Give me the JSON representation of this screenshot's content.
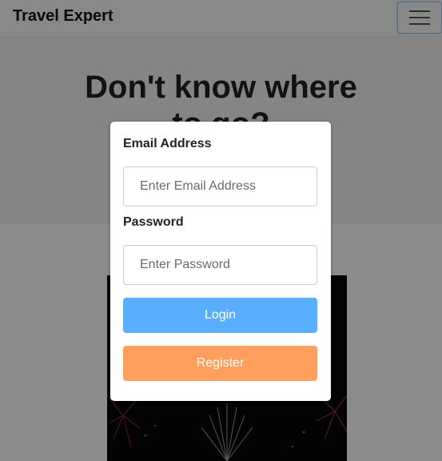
{
  "navbar": {
    "brand": "Travel Expert",
    "menu_icon": "hamburger-menu-icon"
  },
  "hero": {
    "title_line1": "Don't know where",
    "title_line2": "to go?"
  },
  "login_modal": {
    "email_label": "Email Address",
    "email_placeholder": "Enter Email Address",
    "email_value": "",
    "password_label": "Password",
    "password_placeholder": "Enter Password",
    "password_value": "",
    "login_label": "Login",
    "register_label": "Register"
  },
  "colors": {
    "login_button": "#5aaeff",
    "register_button": "#ff9f5e",
    "overlay": "rgba(0,0,0,0.45)"
  }
}
